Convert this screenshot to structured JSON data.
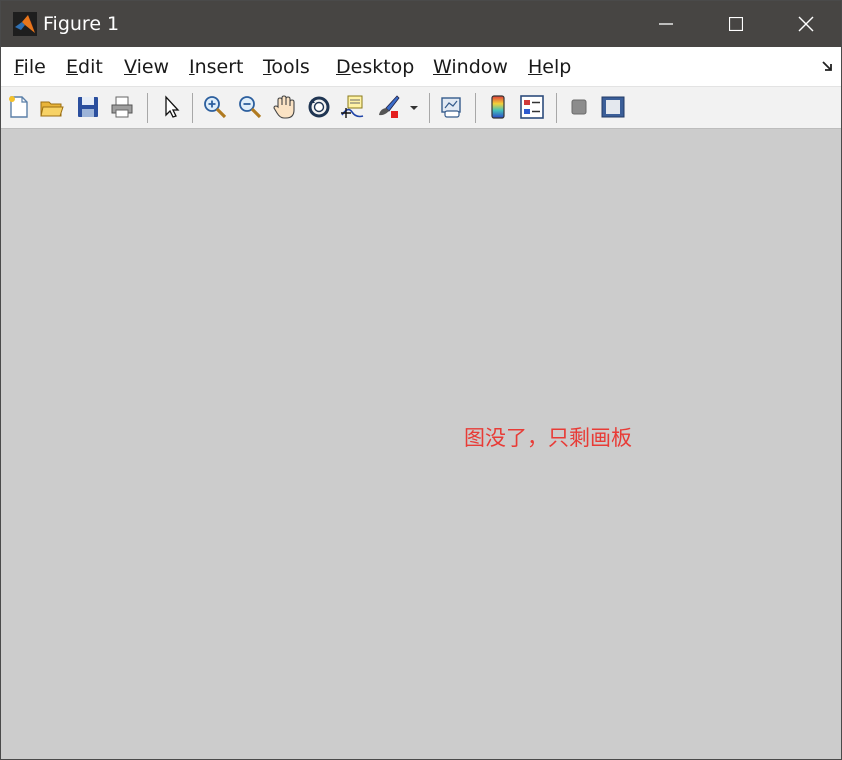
{
  "window": {
    "title": "Figure 1"
  },
  "menu": {
    "file": {
      "mnemonic": "F",
      "rest": "ile"
    },
    "edit": {
      "mnemonic": "E",
      "rest": "dit"
    },
    "view": {
      "mnemonic": "V",
      "rest": "iew"
    },
    "insert": {
      "mnemonic": "I",
      "rest": "nsert"
    },
    "tools": {
      "mnemonic": "T",
      "rest": "ools"
    },
    "desktop": {
      "mnemonic": "D",
      "rest": "esktop"
    },
    "window": {
      "mnemonic": "W",
      "rest": "indow"
    },
    "help": {
      "mnemonic": "H",
      "rest": "elp"
    }
  },
  "toolbar": {
    "icons": [
      "new-figure-icon",
      "open-file-icon",
      "save-icon",
      "print-icon",
      "edit-plot-arrow-icon",
      "zoom-in-icon",
      "zoom-out-icon",
      "pan-hand-icon",
      "rotate-3d-icon",
      "data-cursor-icon",
      "brush-icon",
      "link-plot-icon",
      "colorbar-icon",
      "legend-icon",
      "hide-plot-tools-icon",
      "show-plot-tools-icon"
    ]
  },
  "canvas": {
    "annotation": "图没了，只剩画板",
    "annotation_color": "#e83b36",
    "background": "#cccccc"
  }
}
